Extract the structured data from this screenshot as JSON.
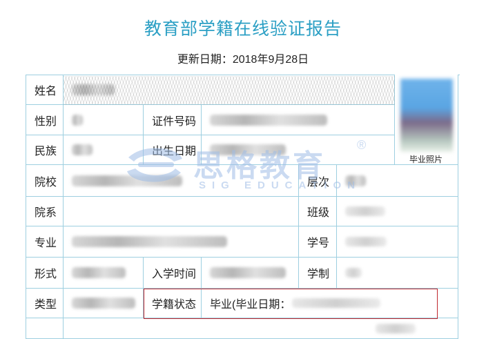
{
  "header": {
    "title": "教育部学籍在线验证报告",
    "update_date": "更新日期：2018年9月28日"
  },
  "labels": {
    "name": "姓名",
    "gender": "性别",
    "id_number": "证件号码",
    "ethnicity": "民族",
    "birth_date": "出生日期",
    "school": "院校",
    "level": "层次",
    "department": "院系",
    "class": "班级",
    "major": "专业",
    "student_id": "学号",
    "form": "形式",
    "enrollment_time": "入学时间",
    "duration": "学制",
    "type": "类型",
    "status": "学籍状态",
    "photo": "毕业照片"
  },
  "values": {
    "status": "毕业(毕业日期："
  },
  "watermark": {
    "text": "思格教育",
    "registered": "®",
    "subtitle": "SIG EDUCATION"
  },
  "colors": {
    "title": "#2b9fc4",
    "border": "#9dcfe0",
    "highlight": "#c0262d"
  }
}
